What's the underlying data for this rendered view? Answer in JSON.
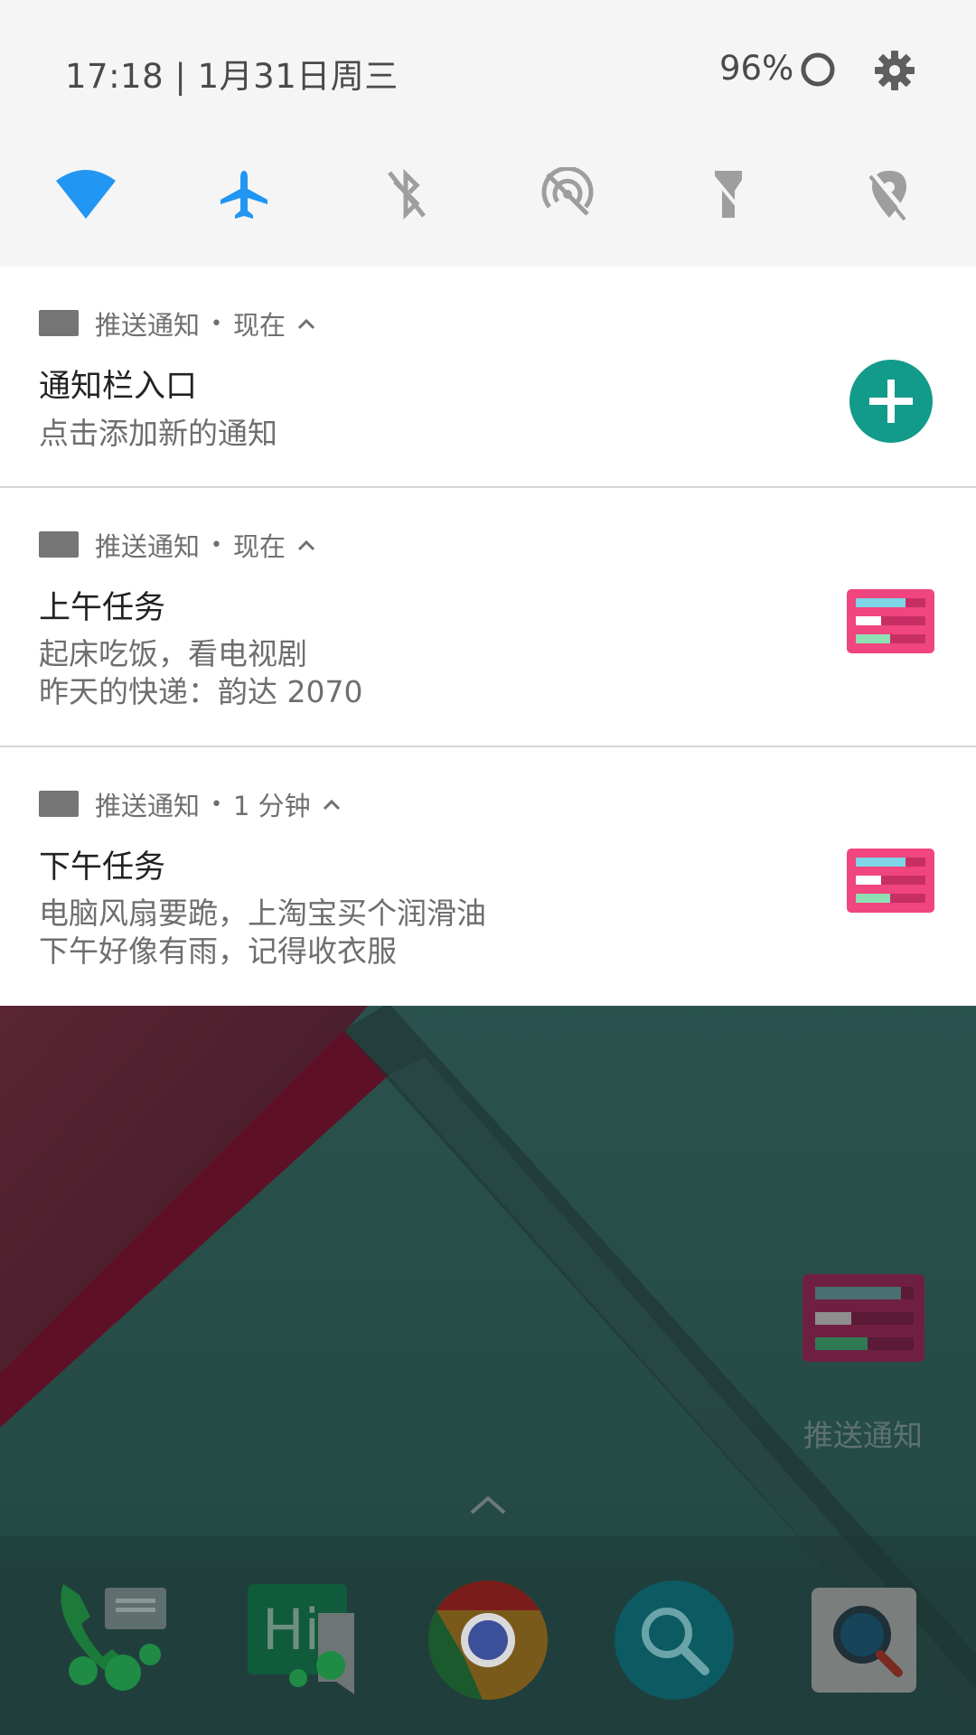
{
  "quick_settings": {
    "datetime": "17:18 | 1月31日周三",
    "battery_percent": "96%",
    "tiles": [
      {
        "name": "wifi-icon",
        "active": true
      },
      {
        "name": "airplane-icon",
        "active": true
      },
      {
        "name": "bluetooth-off-icon",
        "active": false
      },
      {
        "name": "hotspot-off-icon",
        "active": false
      },
      {
        "name": "flashlight-off-icon",
        "active": false
      },
      {
        "name": "location-off-icon",
        "active": false
      }
    ],
    "active_color": "#2196f3",
    "inactive_color": "#9e9e9e"
  },
  "notifications": [
    {
      "app": "推送通知",
      "time": "现在",
      "title": "通知栏入口",
      "lines": [
        "点击添加新的通知"
      ],
      "action_icon": "add-icon"
    },
    {
      "app": "推送通知",
      "time": "现在",
      "title": "上午任务",
      "lines": [
        "起床吃饭，看电视剧",
        "昨天的快递：韵达 2070"
      ],
      "large_icon": "task-list-icon"
    },
    {
      "app": "推送通知",
      "time": "1 分钟",
      "title": "下午任务",
      "lines": [
        "电脑风扇要跪，上淘宝买个润滑油",
        "下午好像有雨，记得收衣服"
      ],
      "large_icon": "task-list-icon"
    }
  ],
  "home": {
    "shortcut_label": "推送通知",
    "dock": [
      "phone-icon",
      "hangouts-icon",
      "chrome-icon",
      "search-icon",
      "magnifier-app-icon"
    ]
  },
  "colors": {
    "accent_teal": "#129a8a",
    "task_icon_pink": "#f0457f",
    "panel_bg": "#f5f5f5"
  }
}
